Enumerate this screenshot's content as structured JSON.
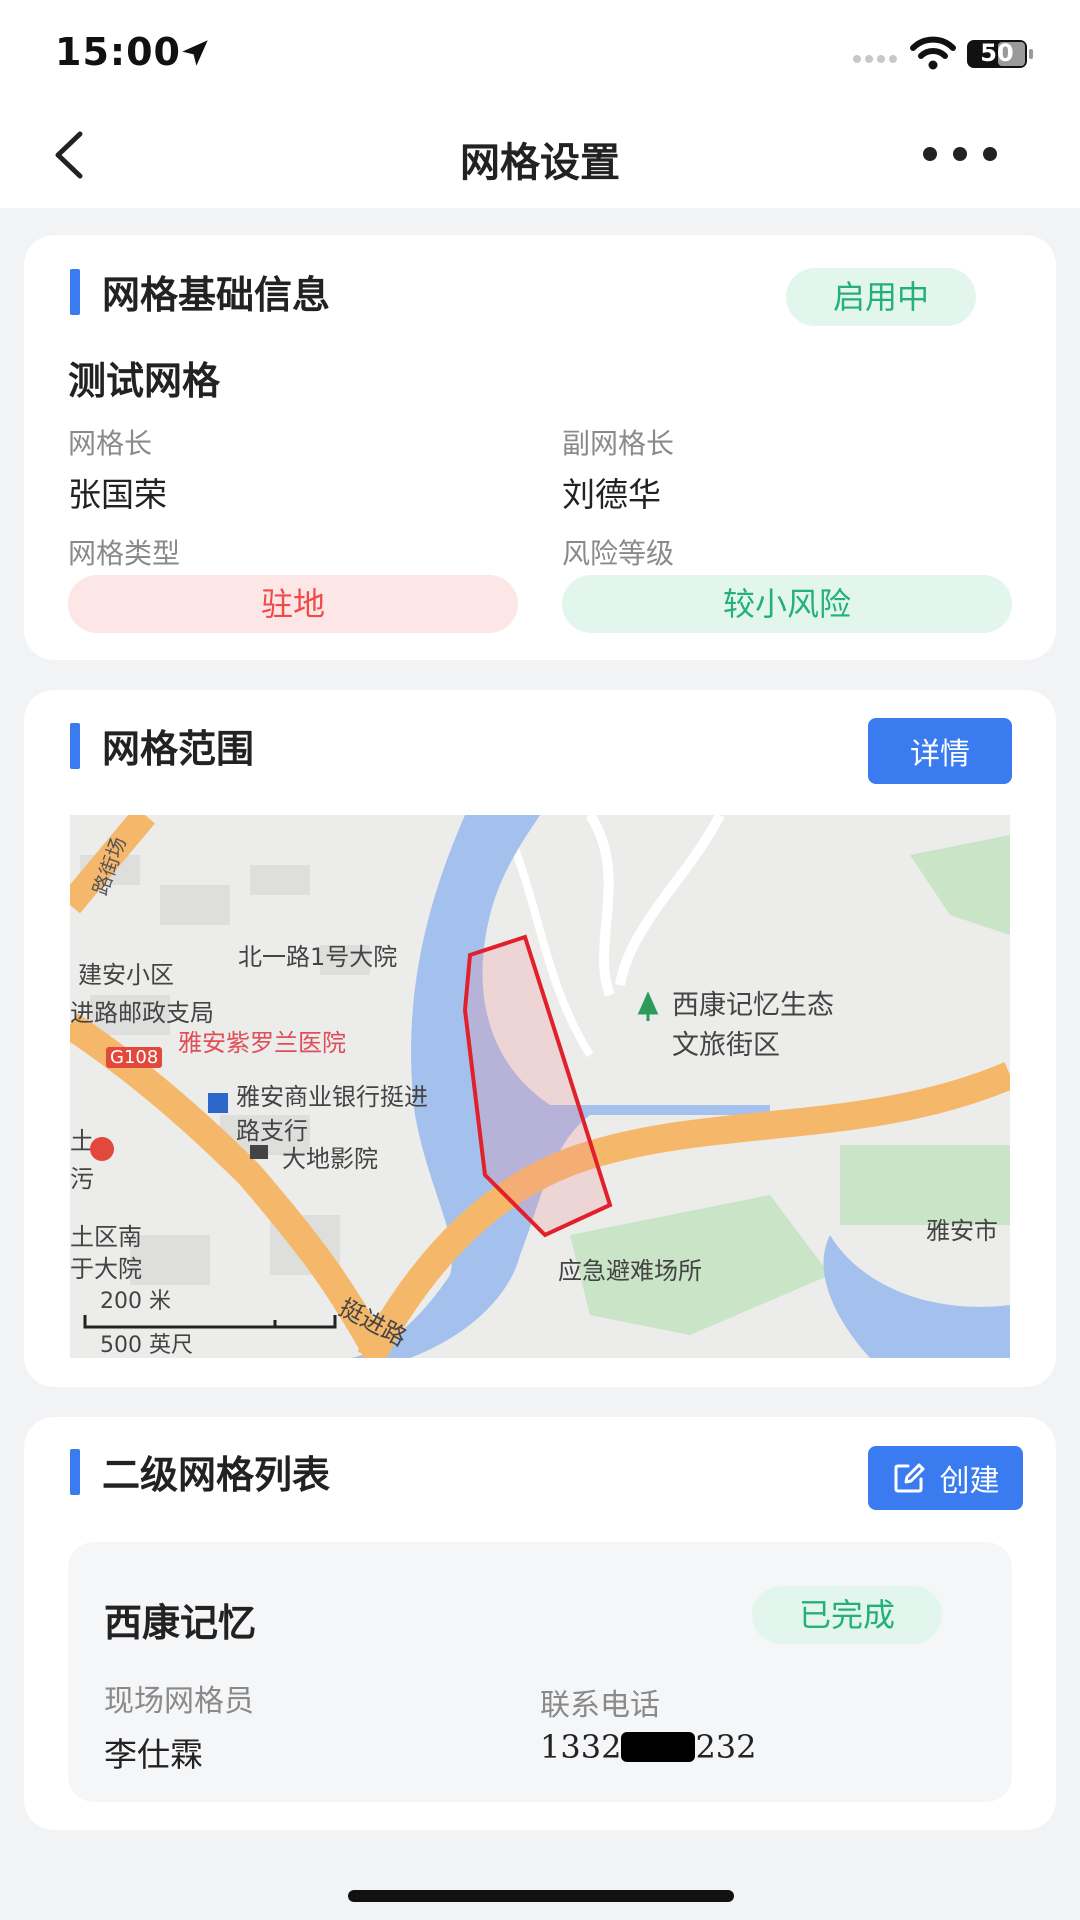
{
  "status_bar": {
    "time": "15:00",
    "battery": "50"
  },
  "nav": {
    "title": "网格设置"
  },
  "basic_info": {
    "section_title": "网格基础信息",
    "status": "启用中",
    "grid_name": "测试网格",
    "leader_label": "网格长",
    "leader": "张国荣",
    "deputy_label": "副网格长",
    "deputy": "刘德华",
    "type_label": "网格类型",
    "type": "驻地",
    "risk_label": "风险等级",
    "risk": "较小风险"
  },
  "range": {
    "section_title": "网格范围",
    "detail_label": "详情",
    "map": {
      "labels": {
        "road_top": "路街场",
        "residential": "建安小区",
        "building": "北一路1号大院",
        "post": "进路邮政支局",
        "hospital": "雅安紫罗兰医院",
        "highway": "G108",
        "bank_line1": "雅安商业银行挺进",
        "bank_line2": "路支行",
        "cinema": "大地影院",
        "scenic_line1": "西康记忆生态",
        "scenic_line2": "文旅街区",
        "city": "雅安市",
        "shelter": "应急避难场所",
        "district_line1": "土区南",
        "district_line2": "于大院",
        "road_bottom": "挺进路",
        "left_char1": "土",
        "left_char2": "污"
      },
      "scale_metric": "200 米",
      "scale_imperial": "500 英尺"
    }
  },
  "sub_grids": {
    "section_title": "二级网格列表",
    "create_label": "创建",
    "items": [
      {
        "name": "西康记忆",
        "status": "已完成",
        "staff_label": "现场网格员",
        "staff": "李仕霖",
        "phone_label": "联系电话",
        "phone_prefix": "1332",
        "phone_suffix": "232"
      }
    ]
  },
  "colors": {
    "accent": "#3a7bf0",
    "green_text": "#23b07a",
    "green_bg": "#e3f6ee",
    "red_text": "#f04b4b",
    "red_bg": "#fde6e6"
  }
}
